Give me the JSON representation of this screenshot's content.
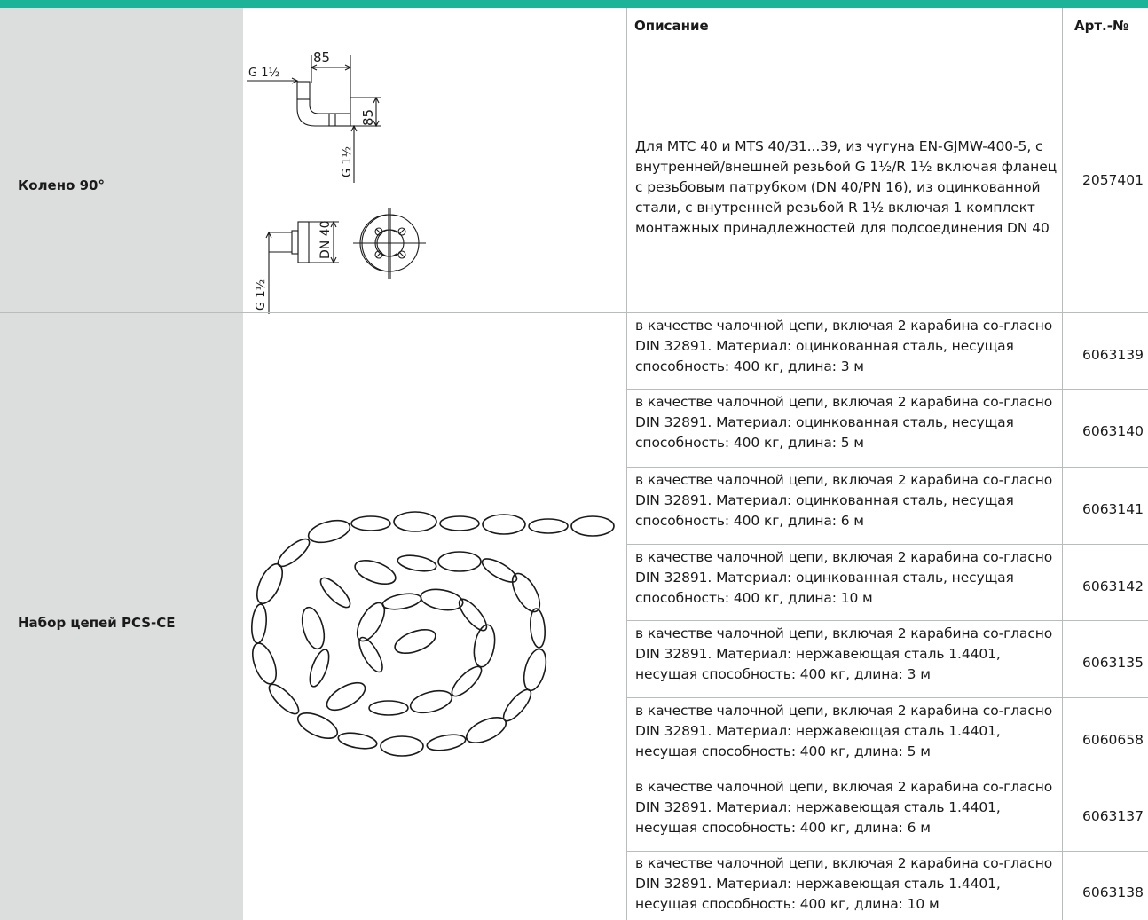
{
  "header": {
    "description": "Описание",
    "article": "Арт.-№"
  },
  "products": [
    {
      "name": "Колено 90°",
      "rows": [
        {
          "description": "Для MTC 40 и MTS 40/31...39, из чугуна EN-GJMW-400-5, с внутренней/внешней резьбой G 1½/R 1½ включая фланец с резьбовым патрубком (DN 40/PN 16), из оцинкованной стали, с внутренней резьбой R 1½ включая 1 комплект монтажных принадлежностей для подсоединения DN 40",
          "article": "2057401"
        }
      ]
    },
    {
      "name": "Набор цепей PCS-CE",
      "rows": [
        {
          "description": "в качестве чалочной цепи, включая 2 карабина со-гласно DIN 32891. Материал: оцинкованная сталь, несущая способность: 400 кг, длина: 3 м",
          "article": "6063139"
        },
        {
          "description": "в качестве чалочной цепи, включая 2 карабина со-гласно DIN 32891. Материал: оцинкованная сталь, несущая способность: 400 кг, длина: 5 м",
          "article": "6063140"
        },
        {
          "description": "в качестве чалочной цепи, включая 2 карабина со-гласно DIN 32891. Материал: оцинкованная сталь, несущая способность: 400 кг, длина: 6 м",
          "article": "6063141"
        },
        {
          "description": "в качестве чалочной цепи, включая 2 карабина со-гласно DIN 32891. Материал: оцинкованная сталь, несущая способность: 400 кг, длина: 10 м",
          "article": "6063142"
        },
        {
          "description": "в качестве чалочной цепи, включая 2 карабина со-гласно DIN 32891. Материал: нержавеющая сталь 1.4401, несущая способность: 400 кг, длина: 3 м",
          "article": "6063135"
        },
        {
          "description": "в качестве чалочной цепи, включая 2 карабина со-гласно DIN 32891. Материал: нержавеющая сталь 1.4401, несущая способность: 400 кг, длина: 5 м",
          "article": "6060658"
        },
        {
          "description": "в качестве чалочной цепи, включая 2 карабина со-гласно DIN 32891. Материал: нержавеющая сталь 1.4401, несущая способность: 400 кг, длина: 6 м",
          "article": "6063137"
        },
        {
          "description": "в качестве чалочной цепи, включая 2 карабина со-гласно DIN 32891. Материал: нержавеющая сталь 1.4401, несущая способность: 400 кг, длина: 10 м",
          "article": "6063138"
        }
      ]
    }
  ],
  "drawing": {
    "dim_85_top": "85",
    "dim_85_side": "85",
    "thread_g_top": "G 1½",
    "thread_g_vertical": "G 1½",
    "flange_dn": "DN 40",
    "flange_thread": "G 1½"
  }
}
